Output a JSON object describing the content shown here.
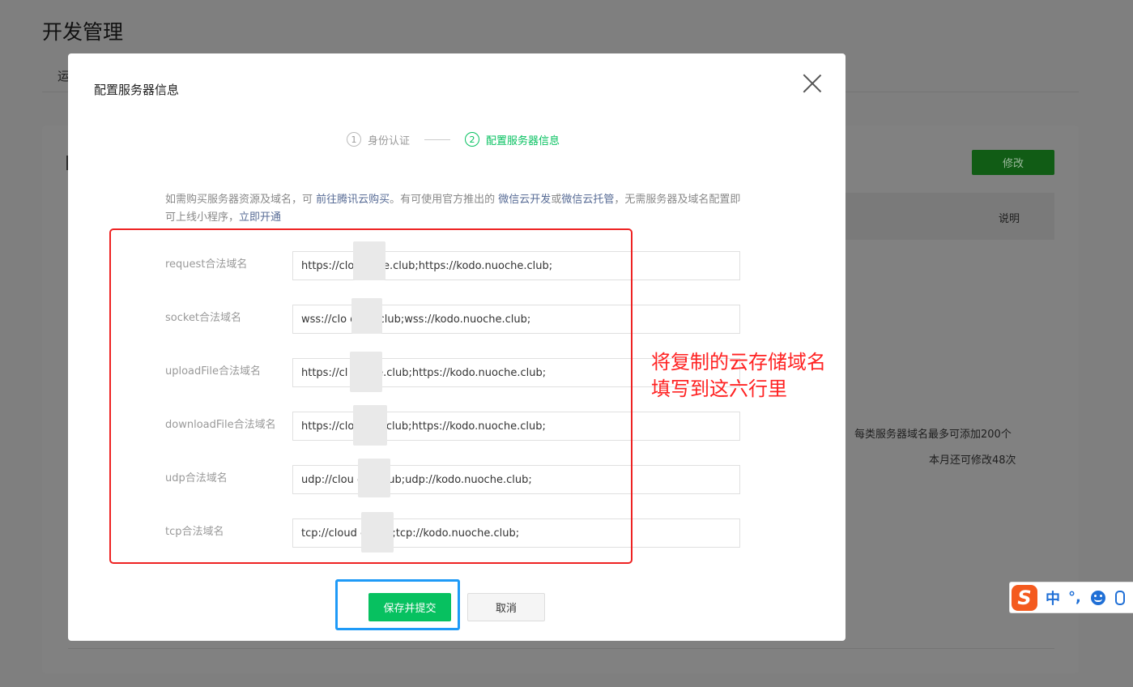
{
  "background": {
    "page_title": "开发管理",
    "tab_partial": "运",
    "edit_button": "修改",
    "column_note": "说明",
    "domain_limit": "每类服务器域名最多可添加200个",
    "remaining_edits": "本月还可修改48次"
  },
  "modal": {
    "title": "配置服务器信息",
    "steps": [
      {
        "num": "1",
        "label": "身份认证",
        "state": "done"
      },
      {
        "num": "2",
        "label": "配置服务器信息",
        "state": "active"
      }
    ],
    "notice": {
      "part1": "如需购买服务器资源及域名，可 ",
      "link1": "前往腾讯云购买",
      "part2": "。有可使用官方推出的 ",
      "link2": "微信云开发",
      "part3": "或",
      "link3": "微信云托管",
      "part4": "，无需服务器及域名配置即可上线小程序，",
      "link4": "立即开通"
    },
    "fields": [
      {
        "label": "request合法域名",
        "value": "https://clo     uoche.club;https://kodo.nuoche.club;"
      },
      {
        "label": "socket合法域名",
        "value": "wss://clo     oche.club;wss://kodo.nuoche.club;"
      },
      {
        "label": "uploadFile合法域名",
        "value": "https://cl      uoche.club;https://kodo.nuoche.club;"
      },
      {
        "label": "downloadFile合法域名",
        "value": "https://clo      oche.club;https://kodo.nuoche.club;"
      },
      {
        "label": "udp合法域名",
        "value": "udp://clou       che.club;udp://kodo.nuoche.club;"
      },
      {
        "label": "tcp合法域名",
        "value": "tcp://cloud       e.club;tcp://kodo.nuoche.club;"
      }
    ],
    "save_button": "保存并提交",
    "cancel_button": "取消"
  },
  "annotation": {
    "line1": "将复制的云存储域名",
    "line2": "填写到这六行里"
  },
  "ime": {
    "logo": "S",
    "mode": "中",
    "punct": "°,"
  },
  "colors": {
    "accent": "#07c160",
    "link": "#576b95",
    "annotation_red": "#ee2222",
    "highlight_blue": "#1e9af7"
  }
}
